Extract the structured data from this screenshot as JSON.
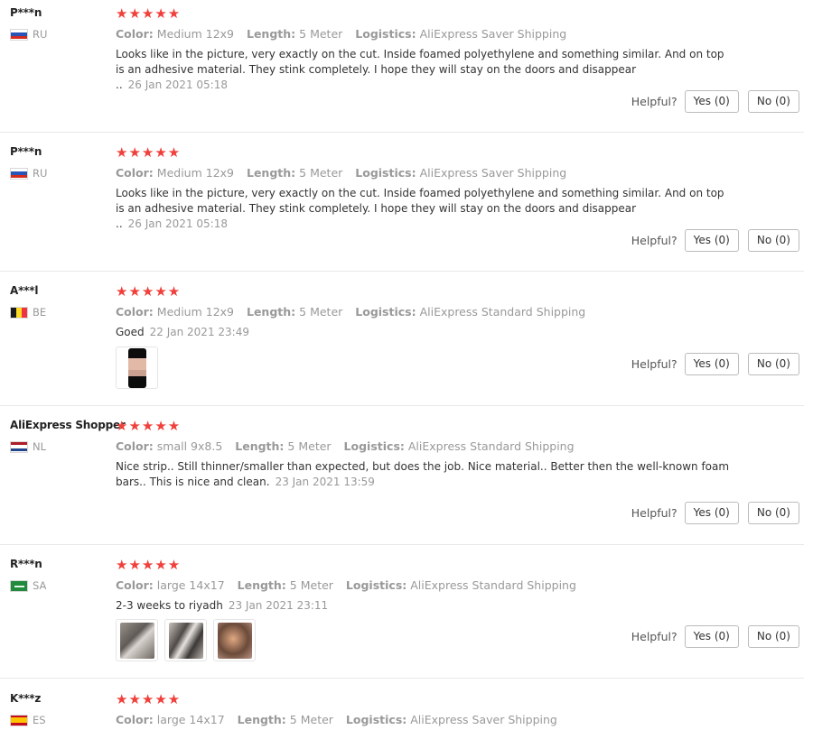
{
  "labels": {
    "color": "Color:",
    "length": "Length:",
    "logistics": "Logistics:",
    "helpful": "Helpful?",
    "stars": "★★★★★"
  },
  "reviews": [
    {
      "user": "P***n",
      "country": "RU",
      "flag": "ru",
      "rating": 5,
      "color": "Medium 12x9",
      "length": "5 Meter",
      "logistics": "AliExpress Saver Shipping",
      "text": "Looks like in the picture, very exactly on the cut. Inside foamed polyethylene and something similar. And on top is an adhesive material. They stink completely. I hope they will stay on the doors and disappear ..",
      "date": "26 Jan 2021 05:18",
      "yes": "Yes (0)",
      "no": "No (0)"
    },
    {
      "user": "P***n",
      "country": "RU",
      "flag": "ru",
      "rating": 5,
      "color": "Medium 12x9",
      "length": "5 Meter",
      "logistics": "AliExpress Saver Shipping",
      "text": "Looks like in the picture, very exactly on the cut. Inside foamed polyethylene and something similar. And on top is an adhesive material. They stink completely. I hope they will stay on the doors and disappear ..",
      "date": "26 Jan 2021 05:18",
      "yes": "Yes (0)",
      "no": "No (0)"
    },
    {
      "user": "A***l",
      "country": "BE",
      "flag": "be",
      "rating": 5,
      "color": "Medium 12x9",
      "length": "5 Meter",
      "logistics": "AliExpress Standard Shipping",
      "text": "Goed",
      "date": "22 Jan 2021 23:49",
      "yes": "Yes (0)",
      "no": "No (0)"
    },
    {
      "user": "AliExpress Shopper",
      "country": "NL",
      "flag": "nl",
      "rating": 5,
      "color": "small 9x8.5",
      "length": "5 Meter",
      "logistics": "AliExpress Standard Shipping",
      "text": "Nice strip.. Still thinner/smaller than expected, but does the job. Nice material.. Better then the well-known foam bars.. This is nice and clean.",
      "date": "23 Jan 2021 13:59",
      "yes": "Yes (0)",
      "no": "No (0)"
    },
    {
      "user": "R***n",
      "country": "SA",
      "flag": "sa",
      "rating": 5,
      "color": "large 14x17",
      "length": "5 Meter",
      "logistics": "AliExpress Standard Shipping",
      "text": "2-3 weeks to riyadh",
      "date": "23 Jan 2021 23:11",
      "yes": "Yes (0)",
      "no": "No (0)"
    },
    {
      "user": "K***z",
      "country": "ES",
      "flag": "es",
      "rating": 5,
      "color": "large 14x17",
      "length": "5 Meter",
      "logistics": "AliExpress Saver Shipping"
    }
  ]
}
